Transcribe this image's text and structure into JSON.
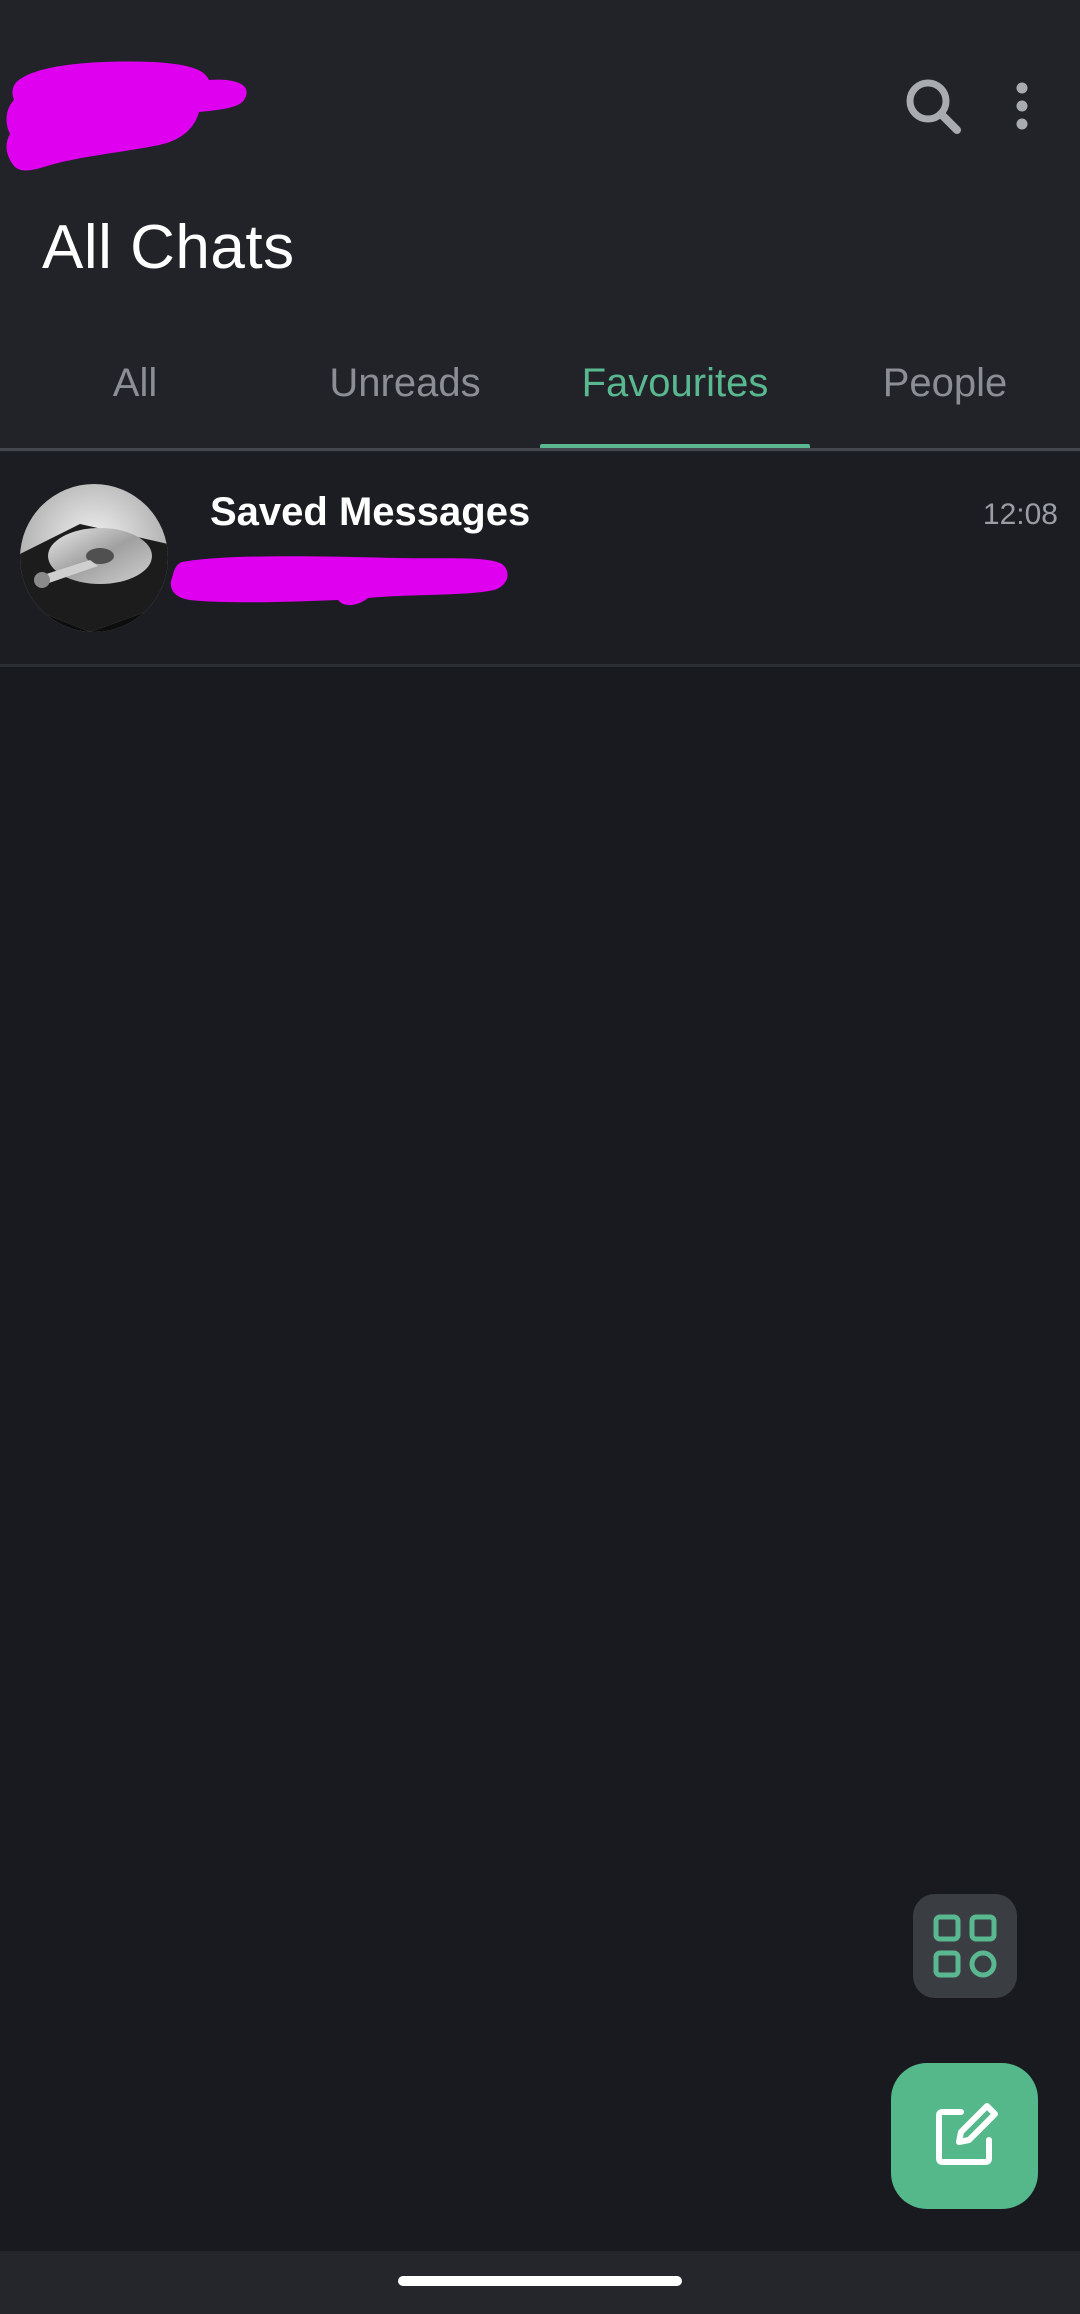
{
  "header": {
    "title": "All Chats",
    "search_icon": "search-icon",
    "more_icon": "more-vertical-icon"
  },
  "tabs": [
    {
      "label": "All",
      "active": false
    },
    {
      "label": "Unreads",
      "active": false
    },
    {
      "label": "Favourites",
      "active": true
    },
    {
      "label": "People",
      "active": false
    }
  ],
  "chats": [
    {
      "name": "Saved Messages",
      "time": "12:08",
      "avatar_icon": "hard-drive-avatar"
    }
  ],
  "fabs": {
    "filters_icon": "grid-shapes-icon",
    "compose_icon": "compose-icon"
  },
  "colors": {
    "accent": "#5ab890",
    "redaction": "#e000f0",
    "header_bg": "#212328",
    "body_bg": "#181a1f"
  }
}
